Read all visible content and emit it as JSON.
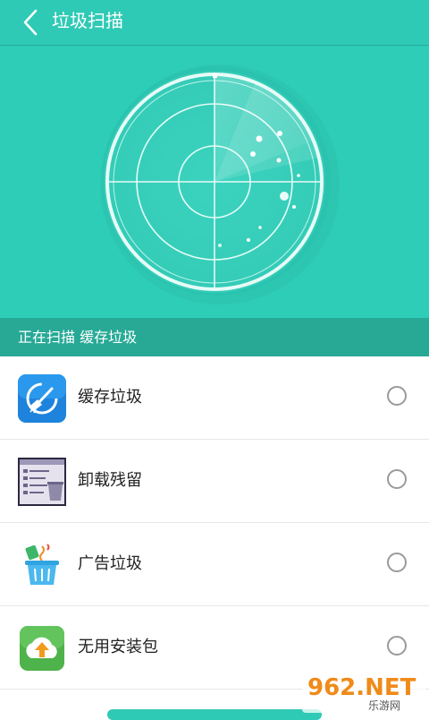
{
  "header": {
    "title": "垃圾扫描"
  },
  "scan": {
    "status_text": "正在扫描 缓存垃圾"
  },
  "items": [
    {
      "label": "缓存垃圾",
      "icon": "broom-clean-icon",
      "checked": false
    },
    {
      "label": "卸载残留",
      "icon": "uninstall-residue-icon",
      "checked": false
    },
    {
      "label": "广告垃圾",
      "icon": "ad-trash-bin-icon",
      "checked": false
    },
    {
      "label": "无用安装包",
      "icon": "cloud-upload-package-icon",
      "checked": false
    }
  ],
  "watermark": {
    "brand": "962.NET",
    "sub": "乐游网"
  },
  "colors": {
    "primary": "#2fcab5",
    "status_bar": "#27a996",
    "radar_ring": "#e6fbf7"
  }
}
